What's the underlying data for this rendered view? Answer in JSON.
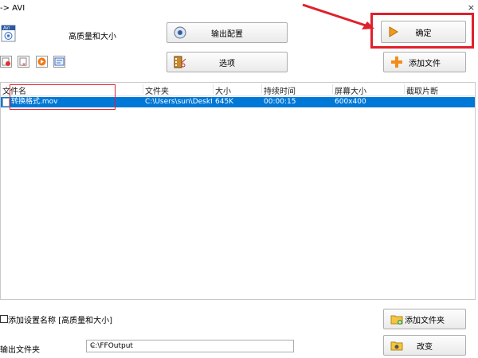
{
  "window": {
    "title": "-> AVI",
    "close_glyph": "×"
  },
  "profile": {
    "icon": "avi-file-icon",
    "label": "高质量和大小"
  },
  "buttons": {
    "output_config": "输出配置",
    "options": "选项",
    "ok": "确定",
    "add_file": "添加文件",
    "add_folder": "添加文件夹",
    "change": "改变"
  },
  "toolbar": {
    "icons": [
      "remove-icon",
      "delete-icon",
      "play-icon",
      "info-icon"
    ]
  },
  "table": {
    "columns": [
      "文件名",
      "文件夹",
      "大小",
      "持续时间",
      "屏幕大小",
      "截取片断"
    ],
    "rows": [
      {
        "name": "转换格式.mov",
        "folder": "C:\\Users\\sun\\Desktop",
        "size": "645K",
        "duration": "00:00:15",
        "screen": "600x400",
        "clip": ""
      }
    ]
  },
  "bottom": {
    "checkbox_label": "添加设置名称 [高质量和大小]",
    "checkbox_checked": false,
    "output_folder_label": "输出文件夹",
    "output_folder_value": "C:\\FFOutput"
  },
  "colors": {
    "selection": "#0078d7",
    "annotation_red": "#e0202c"
  }
}
